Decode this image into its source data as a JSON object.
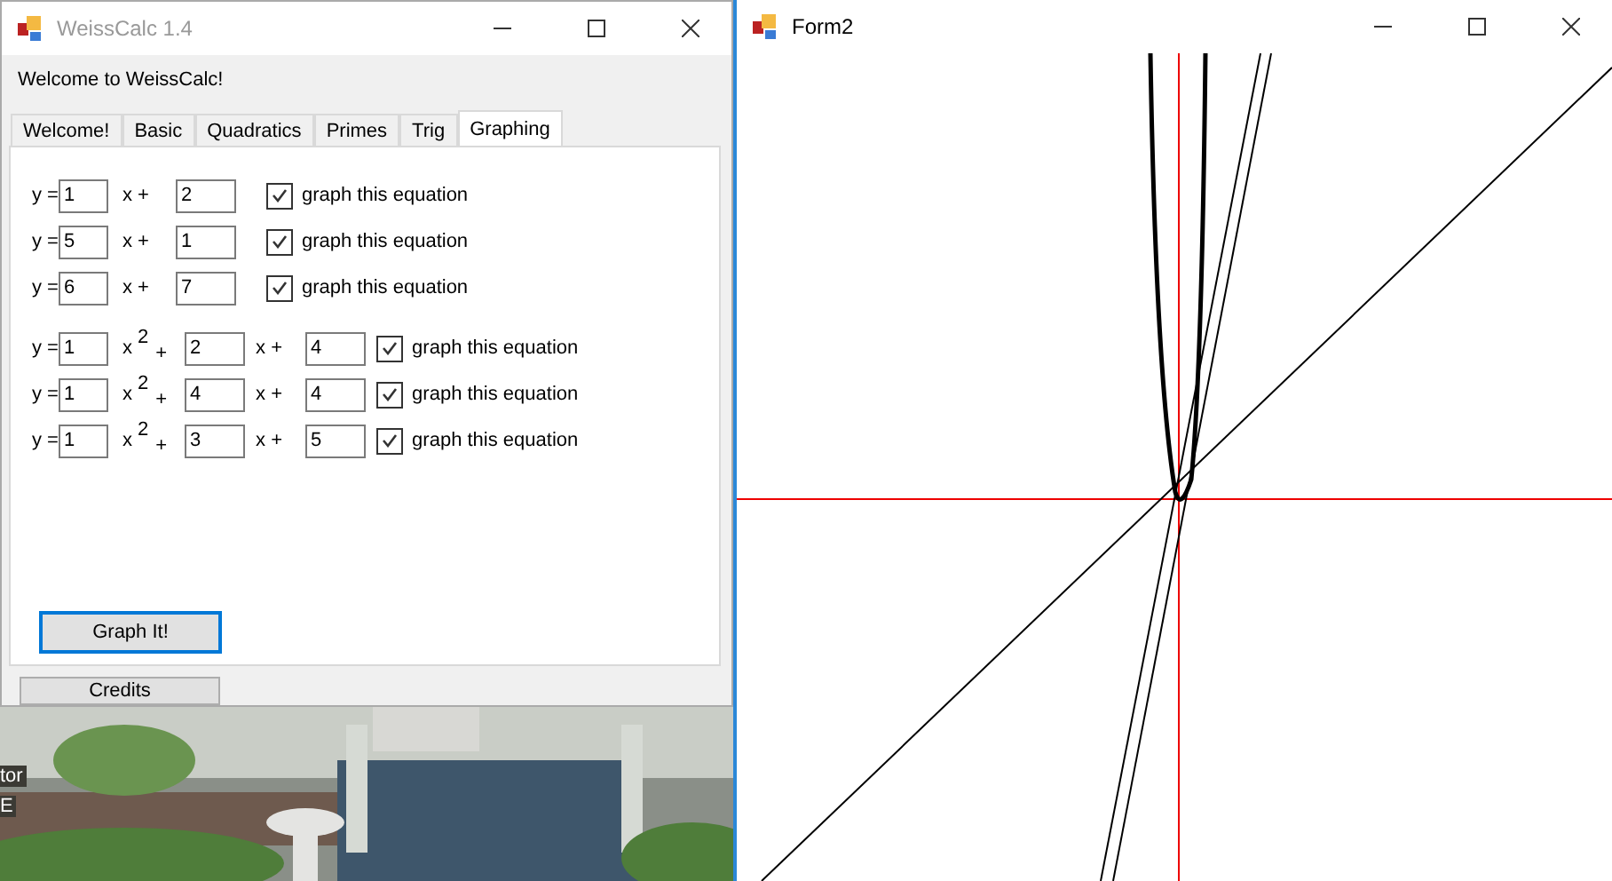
{
  "main_window": {
    "title": "WeissCalc 1.4",
    "welcome": "Welcome to WeissCalc!",
    "tabs": [
      {
        "label": "Welcome!",
        "selected": false
      },
      {
        "label": "Basic",
        "selected": false
      },
      {
        "label": "Quadratics",
        "selected": false
      },
      {
        "label": "Primes",
        "selected": false
      },
      {
        "label": "Trig",
        "selected": false
      },
      {
        "label": "Graphing",
        "selected": true
      }
    ],
    "linear": [
      {
        "y_label": "y =",
        "m": "1",
        "x_label": "x +",
        "b": "2",
        "check_label": "graph this equation",
        "checked": true
      },
      {
        "y_label": "y =",
        "m": "5",
        "x_label": "x +",
        "b": "1",
        "check_label": "graph this equation",
        "checked": true
      },
      {
        "y_label": "y =",
        "m": "6",
        "x_label": "x +",
        "b": "7",
        "check_label": "graph this equation",
        "checked": true
      }
    ],
    "quadratic": [
      {
        "y_label": "y =",
        "a": "1",
        "x2_label": "x",
        "exp": "2",
        "plus": "+",
        "b": "2",
        "x_label": "x +",
        "c": "4",
        "check_label": "graph this equation",
        "checked": true
      },
      {
        "y_label": "y =",
        "a": "1",
        "x2_label": "x",
        "exp": "2",
        "plus": "+",
        "b": "4",
        "x_label": "x +",
        "c": "4",
        "check_label": "graph this equation",
        "checked": true
      },
      {
        "y_label": "y =",
        "a": "1",
        "x2_label": "x",
        "exp": "2",
        "plus": "+",
        "b": "3",
        "x_label": "x +",
        "c": "5",
        "check_label": "graph this equation",
        "checked": true
      }
    ],
    "graph_button": "Graph It!",
    "credits_button": "Credits"
  },
  "desktop": {
    "labels": [
      "tor",
      "E"
    ]
  },
  "graph_window": {
    "title": "Form2"
  }
}
